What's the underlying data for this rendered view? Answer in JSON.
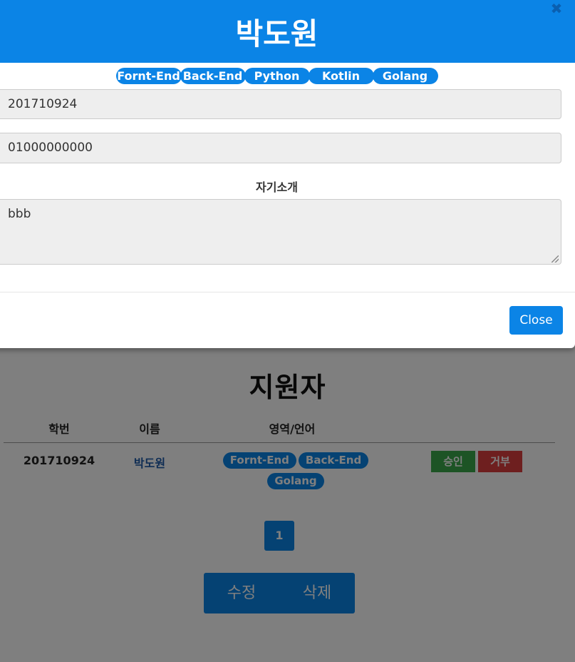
{
  "page": {
    "title": "지원자",
    "columns": [
      "학번",
      "이름",
      "영역/언어",
      ""
    ],
    "rows": [
      {
        "student_id": "201710924",
        "name": "박도원",
        "tags": [
          "Fornt-End",
          "Back-End",
          "Golang"
        ],
        "approve_label": "승인",
        "reject_label": "거부"
      }
    ],
    "pagination": {
      "current": "1"
    },
    "actions": {
      "edit_label": "수정",
      "delete_label": "삭제"
    }
  },
  "modal": {
    "title": "박도원",
    "close_x_icon": "close-icon",
    "tags": [
      "Fornt-End",
      "Back-End",
      "Python",
      "Kotlin",
      "Golang"
    ],
    "student_id": "201710924",
    "phone": "01000000000",
    "intro_label": "자기소개",
    "intro": "bbb",
    "close_label": "Close"
  },
  "colors": {
    "accent": "#0b84e6",
    "approve": "#3aa84a",
    "reject": "#dc3e3e",
    "overlay": "rgba(0,0,0,0.5)"
  }
}
